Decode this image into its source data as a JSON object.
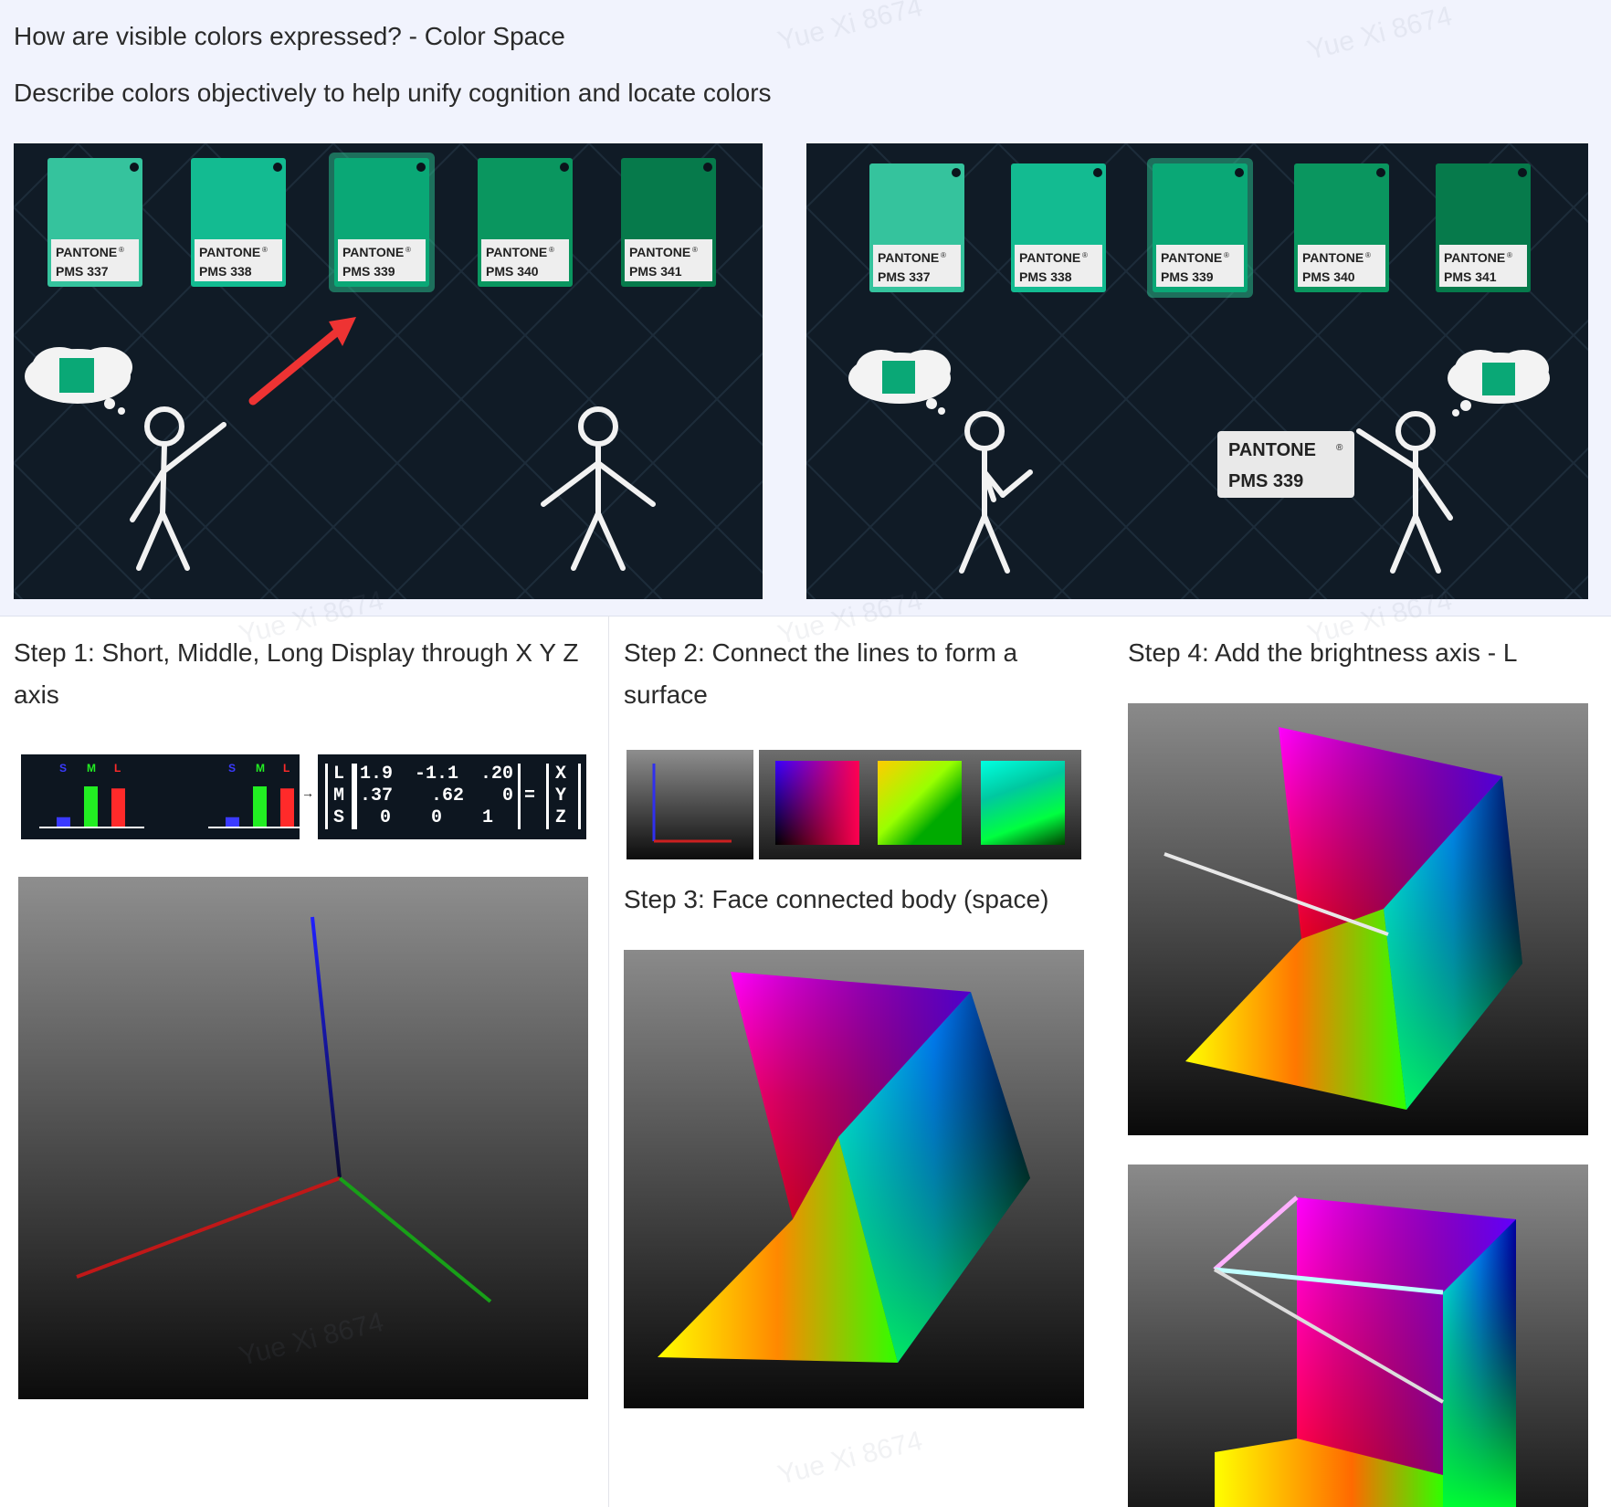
{
  "header": {
    "title": "How are visible colors expressed? - Color Space",
    "subtitle": "Describe colors objectively to help unify cognition and locate colors"
  },
  "swatches": [
    {
      "brand": "PANTONE",
      "code": "PMS 337",
      "color": "#35c39d"
    },
    {
      "brand": "PANTONE",
      "code": "PMS 338",
      "color": "#13bb91"
    },
    {
      "brand": "PANTONE",
      "code": "PMS 339",
      "color": "#0aa876"
    },
    {
      "brand": "PANTONE",
      "code": "PMS 340",
      "color": "#0a965f"
    },
    {
      "brand": "PANTONE",
      "code": "PMS 341",
      "color": "#067a4b"
    }
  ],
  "scene_right": {
    "card_brand": "PANTONE",
    "card_code": "PMS 339"
  },
  "steps": {
    "step1": "Step 1: Short, Middle, Long Display through X Y Z axis",
    "step2": "Step 2: Connect the lines to form a surface",
    "step3": "Step 3: Face connected body (space)",
    "step4": "Step 4: Add the brightness axis - L"
  },
  "lms_strip": {
    "bar_labels": [
      "S",
      "M",
      "L"
    ],
    "bar_colors": [
      "#3a3aff",
      "#22ee22",
      "#ff2a2a"
    ],
    "matrix_left": [
      "L",
      "M",
      "S"
    ],
    "matrix_rows": [
      [
        "1.9",
        "-1.1",
        ".20"
      ],
      [
        ".37",
        ".62",
        "0"
      ],
      [
        "0",
        "0",
        "1"
      ]
    ],
    "equals": "=",
    "matrix_right": [
      "X",
      "Y",
      "Z"
    ],
    "arrow": "→"
  },
  "watermark": "Yue Xi 8674"
}
